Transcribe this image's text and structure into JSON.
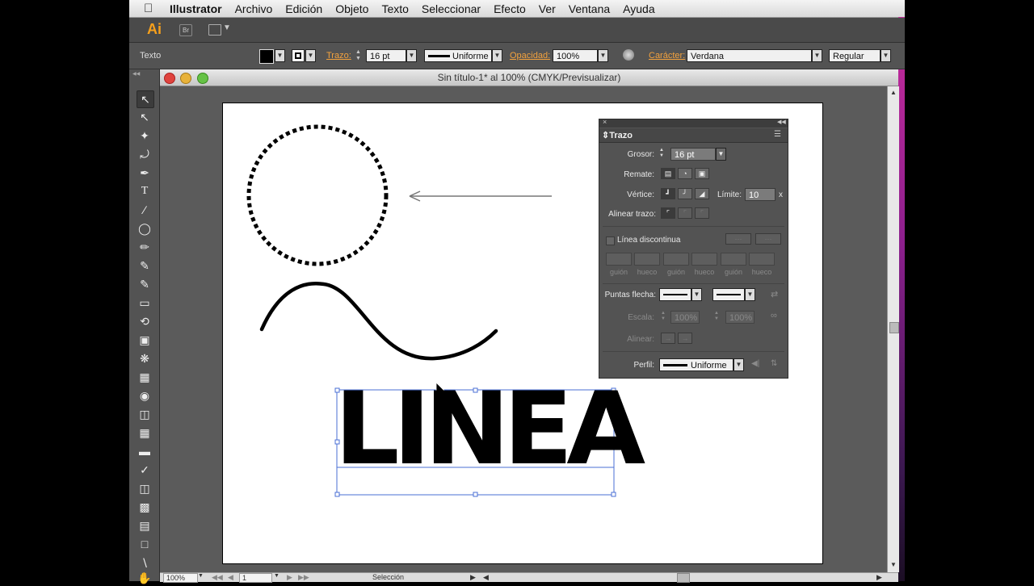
{
  "menubar": {
    "apple": "",
    "app": "Illustrator",
    "items": [
      "Archivo",
      "Edición",
      "Objeto",
      "Texto",
      "Seleccionar",
      "Efecto",
      "Ver",
      "Ventana",
      "Ayuda"
    ]
  },
  "appbar": {
    "logo": "Ai",
    "bridge": "Br"
  },
  "control": {
    "tool_label": "Texto",
    "stroke_label": "Trazo:",
    "stroke_value": "16 pt",
    "profile_value": "Uniforme",
    "opacity_label": "Opacidad:",
    "opacity_value": "100%",
    "char_label": "Carácter:",
    "font_value": "Verdana",
    "style_value": "Regular"
  },
  "document": {
    "title": "Sin título-1* al 100% (CMYK/Previsualizar)",
    "artwork_text": "LINEA"
  },
  "status": {
    "zoom": "100%",
    "artboard": "1",
    "tool": "Selección"
  },
  "stroke_panel": {
    "tab": "Trazo",
    "weight_label": "Grosor:",
    "weight_value": "16 pt",
    "cap_label": "Remate:",
    "corner_label": "Vértice:",
    "limit_label": "Límite:",
    "limit_value": "10",
    "limit_unit": "x",
    "align_label": "Alinear trazo:",
    "dashed_label": "Línea discontinua",
    "dash_labels": [
      "guión",
      "hueco",
      "guión",
      "hueco",
      "guión",
      "hueco"
    ],
    "arrow_label": "Puntas flecha:",
    "scale_label": "Escala:",
    "scale_values": [
      "100%",
      "100%"
    ],
    "align_arrow_label": "Alinear:",
    "profile_label": "Perfil:",
    "profile_value": "Uniforme"
  },
  "colors": {
    "accent": "#f3a23e",
    "ai_logo": "#f7a01c",
    "selection": "#4a6fd6"
  }
}
